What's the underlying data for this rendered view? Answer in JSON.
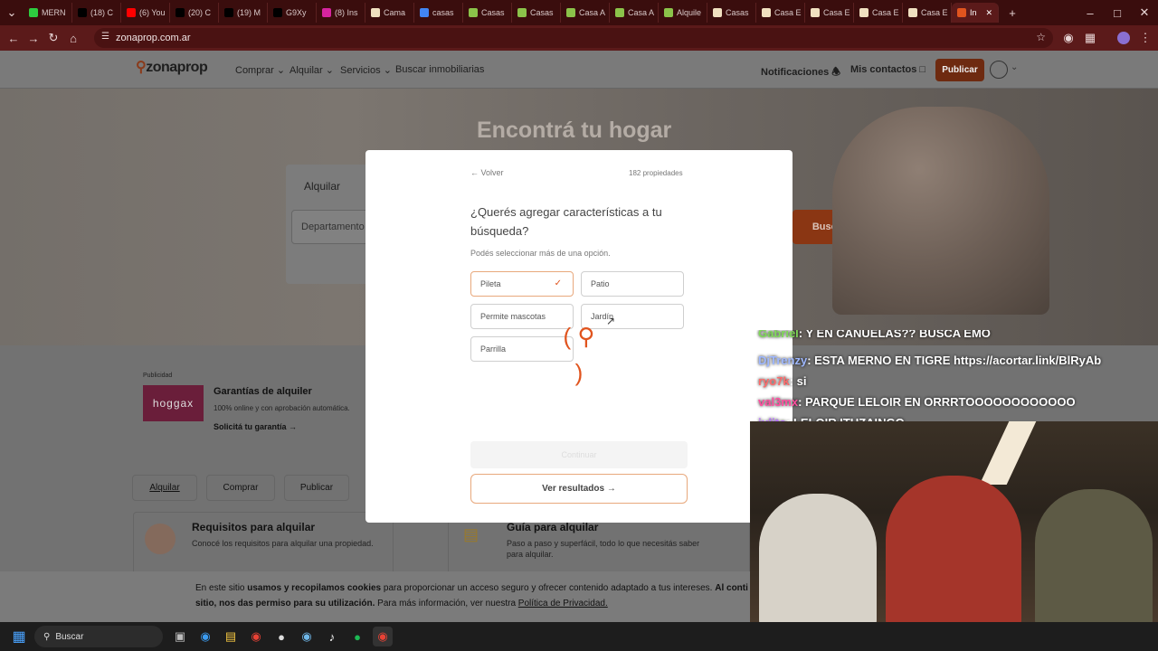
{
  "tabs": [
    {
      "label": "MERN",
      "color": "#2ecc40"
    },
    {
      "label": "(18) C",
      "color": "#000"
    },
    {
      "label": "(6) You",
      "color": "#ff0000"
    },
    {
      "label": "(20) C",
      "color": "#000"
    },
    {
      "label": "(19) M",
      "color": "#000"
    },
    {
      "label": "G9Xy",
      "color": "#000"
    },
    {
      "label": "(8) Ins",
      "color": "#d6249f"
    },
    {
      "label": "Cama",
      "color": "#f0e0c0"
    },
    {
      "label": "casas",
      "color": "#4285f4"
    },
    {
      "label": "Casas",
      "color": "#8bc34a"
    },
    {
      "label": "Casas",
      "color": "#8bc34a"
    },
    {
      "label": "Casa A",
      "color": "#8bc34a"
    },
    {
      "label": "Casa A",
      "color": "#8bc34a"
    },
    {
      "label": "Alquile",
      "color": "#8bc34a"
    },
    {
      "label": "Casas",
      "color": "#f0e0c0"
    },
    {
      "label": "Casa E",
      "color": "#f0e0c0"
    },
    {
      "label": "Casa E",
      "color": "#f0e0c0"
    },
    {
      "label": "Casa E",
      "color": "#f0e0c0"
    },
    {
      "label": "Casa E",
      "color": "#f0e0c0"
    },
    {
      "label": "In",
      "color": "#e0541e",
      "active": true
    }
  ],
  "url": "zonaprop.com.ar",
  "brand": {
    "name": "zonaprop",
    "accent": "#e0541e"
  },
  "header": {
    "nav": [
      "Comprar",
      "Alquilar",
      "Servicios",
      "Buscar inmobiliarias"
    ],
    "notifications": "Notificaciones",
    "contacts": "Mis contactos",
    "publish": "Publicar"
  },
  "hero": {
    "title": "Encontrá tu hogar",
    "tab_rent": "Alquilar",
    "property_type": "Departamento",
    "search_button": "Buscar"
  },
  "ad": {
    "label": "Publicidad",
    "logo": "hoggax",
    "title": "Garantías de alquiler",
    "subtitle": "100% online y con aprobación automática.",
    "cta": "Solicitá tu garantía"
  },
  "tabs_section": [
    "Alquilar",
    "Comprar",
    "Publicar"
  ],
  "cards": [
    {
      "title": "Requisitos para alquilar",
      "text": "Conocé los requisitos para alquilar una propiedad."
    },
    {
      "title": "Guía para alquilar",
      "text": "Paso a paso y superfácil, todo lo que necesitás saber para alquilar."
    }
  ],
  "modal": {
    "back": "Volver",
    "count": "182 propiedades",
    "question": "¿Querés agregar características a tu búsqueda?",
    "hint": "Podés seleccionar más de una opción.",
    "options": [
      {
        "label": "Pileta",
        "selected": true
      },
      {
        "label": "Patio",
        "selected": false
      },
      {
        "label": "Permite mascotas",
        "selected": false
      },
      {
        "label": "Jardín",
        "selected": false
      },
      {
        "label": "Parrilla",
        "selected": false
      }
    ],
    "continue": "Continuar",
    "results": "Ver resultados"
  },
  "cookie": {
    "text_a": "En este sitio ",
    "bold_a": "usamos y recopilamos cookies",
    "text_b": " para proporcionar un acceso seguro y ofrecer contenido adaptado a tus intereses. ",
    "bold_b": "Al conti",
    "line2_bold": "sitio, nos das permiso para su utilización.",
    "line2_text": " Para más información, ver nuestra ",
    "link": "Política de Privacidad."
  },
  "chat": [
    {
      "user": "Gabriel",
      "msg": ": Y EN CANUELAS?? BUSCA EMO",
      "color": "#7fd957"
    },
    {
      "user": "DjTrenzy",
      "msg": ": ESTA MERNO EN TIGRE https://acortar.link/BlRyAb",
      "color": "#9fb8ff"
    },
    {
      "user": "ryo7k",
      "msg": ": si",
      "color": "#ff6b6b"
    },
    {
      "user": "val3mx",
      "msg": ": PARQUE LELOIR EN ORRRTOOOOOOOOOOOO",
      "color": "#ff4fa0"
    },
    {
      "user": "julito",
      "msg": ": LELOIR ITUZAINGO",
      "color": "#b46bff"
    }
  ],
  "taskbar": {
    "search": "Buscar"
  }
}
